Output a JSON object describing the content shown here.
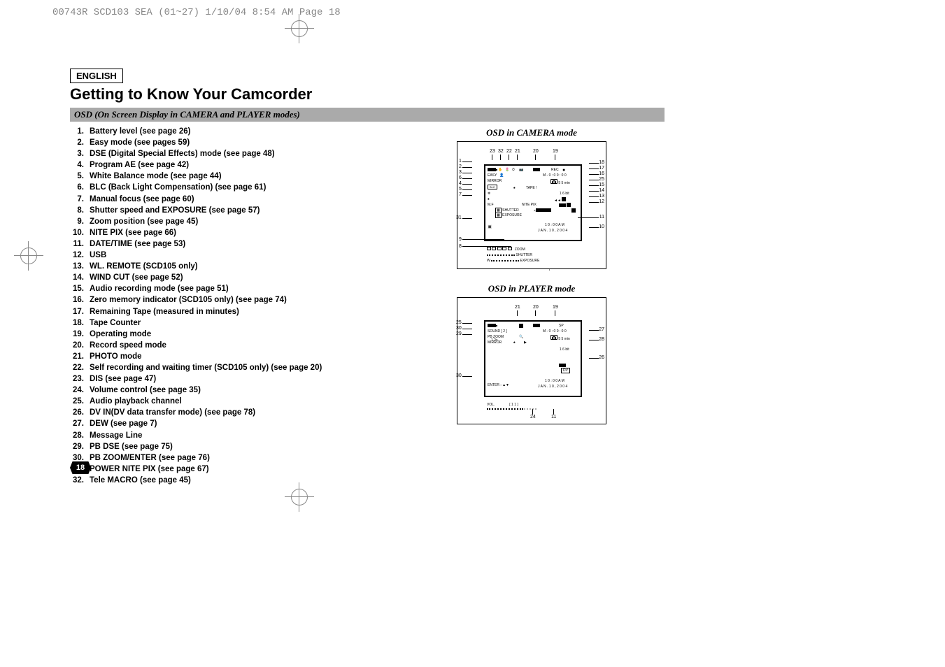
{
  "header_text": "00743R SCD103 SEA (01~27)  1/10/04 8:54 AM  Page 18",
  "lang": "ENGLISH",
  "title": "Getting to Know Your Camcorder",
  "section": "OSD (On Screen Display in CAMERA and PLAYER modes)",
  "page_number": "18",
  "items": [
    {
      "n": "1.",
      "t": "Battery level (see page 26)"
    },
    {
      "n": "2.",
      "t": "Easy mode (see pages 59)"
    },
    {
      "n": "3.",
      "t": "DSE (Digital Special Effects) mode (see page 48)"
    },
    {
      "n": "4.",
      "t": "Program AE (see page 42)"
    },
    {
      "n": "5.",
      "t": "White Balance mode (see page 44)"
    },
    {
      "n": "6.",
      "t": "BLC (Back Light Compensation) (see page 61)"
    },
    {
      "n": "7.",
      "t": "Manual focus (see page 60)"
    },
    {
      "n": "8.",
      "t": "Shutter speed and EXPOSURE (see page 57)"
    },
    {
      "n": "9.",
      "t": "Zoom position (see page 45)"
    },
    {
      "n": "10.",
      "t": "NITE PIX (see page 66)"
    },
    {
      "n": "11.",
      "t": "DATE/TIME (see page 53)"
    },
    {
      "n": "12.",
      "t": "USB"
    },
    {
      "n": "13.",
      "t": "WL. REMOTE (SCD105 only)"
    },
    {
      "n": "14.",
      "t": "WIND CUT (see page 52)"
    },
    {
      "n": "15.",
      "t": "Audio recording mode (see page 51)"
    },
    {
      "n": "16.",
      "t": "Zero memory indicator (SCD105 only) (see page 74)"
    },
    {
      "n": "17.",
      "t": "Remaining Tape (measured in minutes)"
    },
    {
      "n": "18.",
      "t": "Tape Counter"
    },
    {
      "n": "19.",
      "t": "Operating mode"
    },
    {
      "n": "20.",
      "t": "Record speed mode"
    },
    {
      "n": "21.",
      "t": "PHOTO mode"
    },
    {
      "n": "22.",
      "t": "Self recording and waiting timer (SCD105 only) (see page 20)"
    },
    {
      "n": "23.",
      "t": "DIS (see page 47)"
    },
    {
      "n": "24.",
      "t": "Volume control (see page 35)"
    },
    {
      "n": "25.",
      "t": "Audio playback channel"
    },
    {
      "n": "26.",
      "t": "DV IN(DV data transfer mode) (see page 78)"
    },
    {
      "n": "27.",
      "t": "DEW (see page 7)"
    },
    {
      "n": "28.",
      "t": "Message Line"
    },
    {
      "n": "29.",
      "t": "PB DSE (see page 75)"
    },
    {
      "n": "30.",
      "t": "PB ZOOM/ENTER (see page 76)"
    },
    {
      "n": "31.",
      "t": "POWER NITE PIX (see page 67)"
    },
    {
      "n": "32.",
      "t": "Tele MACRO (see page 45)"
    }
  ],
  "osd_camera": {
    "label": "OSD in CAMERA mode",
    "top_nums": [
      "23",
      "32",
      "22",
      "21",
      "20",
      "19"
    ],
    "left_nums": [
      "1",
      "2",
      "3",
      "6",
      "4",
      "5",
      "7",
      "31",
      "9",
      "8"
    ],
    "right_nums": [
      "18",
      "17",
      "16",
      "25",
      "15",
      "14",
      "13",
      "12",
      "11",
      "10"
    ],
    "screen": {
      "easy": "EASY",
      "mirror": "MIRROR",
      "tape": "TAPE !",
      "mf": "M.F",
      "nitepix": "NITE PIX",
      "shutter": "SHUTTER",
      "exposure": "EXPOSURE",
      "rec": "REC",
      "counter": "M - 0 : 0 0 : 0 0",
      "remain": "5 5 min",
      "audio": "1 6 bit",
      "time": "1 0 : 0 0 A M",
      "date": "J A N . 1 0 , 2 0 0 4",
      "zoom": "ZOOM",
      "shutter2": "SHUTTER",
      "exposure2": "EXPOSURE"
    }
  },
  "osd_player": {
    "label": "OSD in PLAYER mode",
    "top_nums": [
      "21",
      "20",
      "19"
    ],
    "left_nums": [
      "25",
      "30",
      "29",
      "30"
    ],
    "right_nums": [
      "27",
      "28",
      "26"
    ],
    "bottom_nums": [
      "24",
      "11"
    ],
    "screen": {
      "sound": "SOUND [ 2 ]",
      "pbzoom": "PB ZOOM",
      "pbzoom_x": "1.2x",
      "mirror": "MIRROR",
      "enter": "ENTER : ▲▼",
      "vol": "VOL.",
      "vol_val": "[ 1 1 ]",
      "counter": "M - 0 : 0 0 : 0 0",
      "remain": "5 5 min",
      "audio": "1 6 bit",
      "dvin": "DV",
      "time": "1 0 : 0 0 A M",
      "date": "J A N . 1 0 , 2 0 0 4",
      "mode": "SP"
    }
  }
}
